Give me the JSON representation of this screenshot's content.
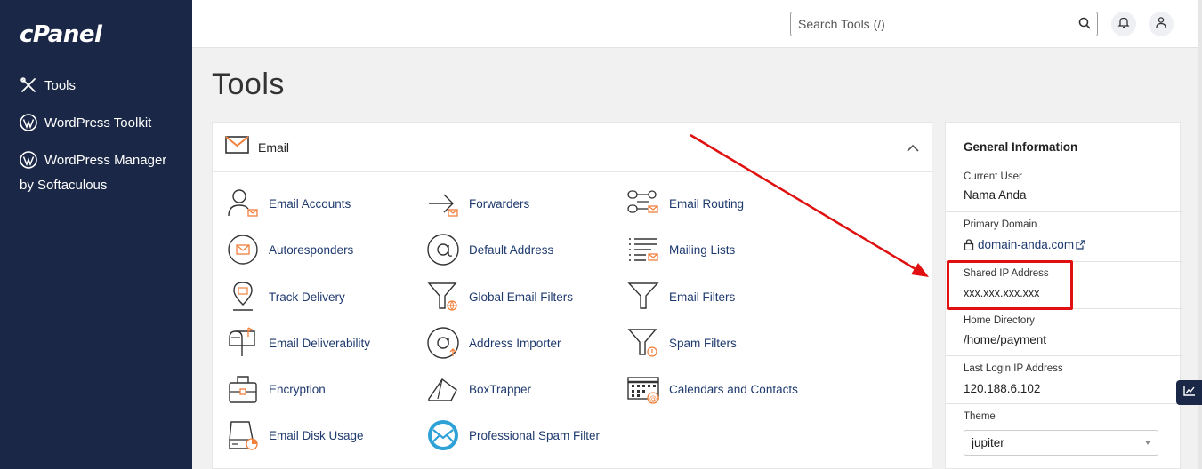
{
  "brand": {
    "logo_text": "cPanel"
  },
  "sidebar": {
    "items": [
      {
        "label": "Tools",
        "icon": "tools-icon"
      },
      {
        "label": "WordPress Toolkit",
        "icon": "wordpress-icon"
      },
      {
        "label": "WordPress Manager",
        "icon": "wordpress-icon"
      }
    ],
    "sub_label": "by Softaculous"
  },
  "topbar": {
    "search_placeholder": "Search Tools (/)",
    "search_icon": "search-icon",
    "notifications_icon": "bell-icon",
    "user_icon": "user-icon"
  },
  "page": {
    "title": "Tools"
  },
  "email_panel": {
    "title": "Email",
    "collapse_icon": "chevron-up-icon",
    "tools": [
      {
        "label": "Email Accounts",
        "icon": "email-accounts-icon"
      },
      {
        "label": "Forwarders",
        "icon": "forwarders-icon"
      },
      {
        "label": "Email Routing",
        "icon": "email-routing-icon"
      },
      {
        "label": "Autoresponders",
        "icon": "autoresponders-icon"
      },
      {
        "label": "Default Address",
        "icon": "default-address-icon"
      },
      {
        "label": "Mailing Lists",
        "icon": "mailing-lists-icon"
      },
      {
        "label": "Track Delivery",
        "icon": "track-delivery-icon"
      },
      {
        "label": "Global Email Filters",
        "icon": "global-email-filters-icon"
      },
      {
        "label": "Email Filters",
        "icon": "email-filters-icon"
      },
      {
        "label": "Email Deliverability",
        "icon": "email-deliverability-icon"
      },
      {
        "label": "Address Importer",
        "icon": "address-importer-icon"
      },
      {
        "label": "Spam Filters",
        "icon": "spam-filters-icon"
      },
      {
        "label": "Encryption",
        "icon": "encryption-icon"
      },
      {
        "label": "BoxTrapper",
        "icon": "boxtrapper-icon"
      },
      {
        "label": "Calendars and Contacts",
        "icon": "calendars-contacts-icon"
      },
      {
        "label": "Email Disk Usage",
        "icon": "email-disk-usage-icon"
      },
      {
        "label": "Professional Spam Filter",
        "icon": "professional-spam-filter-icon"
      }
    ]
  },
  "general_info": {
    "title": "General Information",
    "current_user": {
      "label": "Current User",
      "value": "Nama Anda"
    },
    "primary_domain": {
      "label": "Primary Domain",
      "value": "domain-anda.com"
    },
    "shared_ip": {
      "label": "Shared IP Address",
      "value": "xxx.xxx.xxx.xxx"
    },
    "home_directory": {
      "label": "Home Directory",
      "value": "/home/payment"
    },
    "last_login_ip": {
      "label": "Last Login IP Address",
      "value": "120.188.6.102"
    },
    "theme": {
      "label": "Theme",
      "value": "jupiter"
    }
  },
  "colors": {
    "sidebar_bg": "#1a2746",
    "link": "#1e3a6e",
    "accent_orange": "#f0803c",
    "annotation_red": "#e01010"
  }
}
